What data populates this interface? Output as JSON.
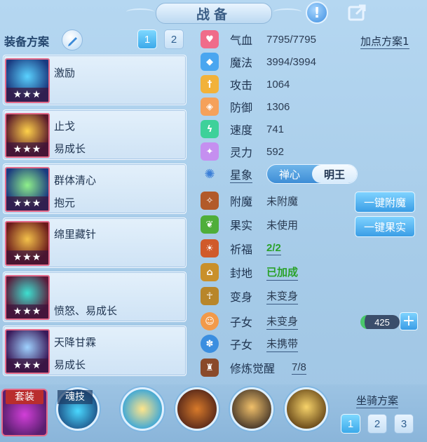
{
  "header": {
    "title": "战备"
  },
  "plan": {
    "label": "装备方案",
    "tabs": [
      "1",
      "2"
    ]
  },
  "equipment": [
    {
      "name": "激励",
      "sub": "",
      "stars": "★★★"
    },
    {
      "name": "止戈",
      "sub": "易成长",
      "stars": "★★★"
    },
    {
      "name": "群体清心",
      "sub": "抱元",
      "stars": "★★★"
    },
    {
      "name": "绵里藏针",
      "sub": "",
      "stars": "★★★"
    },
    {
      "name": "",
      "sub": "愤怒、易成长",
      "stars": "★★★"
    },
    {
      "name": "天降甘霖",
      "sub": "易成长",
      "stars": "★★★"
    }
  ],
  "stats": [
    {
      "label": "气血",
      "value": "7795/7795"
    },
    {
      "label": "魔法",
      "value": "3994/3994"
    },
    {
      "label": "攻击",
      "value": "1064"
    },
    {
      "label": "防御",
      "value": "1306"
    },
    {
      "label": "速度",
      "value": "741"
    },
    {
      "label": "灵力",
      "value": "592"
    }
  ],
  "add_points": "加点方案1",
  "star_sign": {
    "label": "星象",
    "options": [
      "禅心",
      "明王"
    ],
    "selected": "明王"
  },
  "attrs": [
    {
      "label": "附魔",
      "value": "未附魔"
    },
    {
      "label": "果实",
      "value": "未使用"
    },
    {
      "label": "祈福",
      "value": "2/2"
    },
    {
      "label": "封地",
      "value": "已加成"
    },
    {
      "label": "变身",
      "value": "未变身"
    },
    {
      "label": "子女",
      "value": "未变身"
    },
    {
      "label": "子女",
      "value": "未携带"
    },
    {
      "label": "修炼觉醒",
      "value": "7/8"
    }
  ],
  "buttons": {
    "enchant": "一键附魔",
    "fruit": "一键果实"
  },
  "child_counter": "425",
  "bottom": {
    "set_label": "套装",
    "soul_label": "魂技",
    "mount_plan": "坐骑方案",
    "mount_tabs": [
      "1",
      "2",
      "3"
    ]
  },
  "colors": {
    "accent": "#3ba9ea",
    "green": "#2aa22a",
    "card_border": "#e46a8a"
  }
}
